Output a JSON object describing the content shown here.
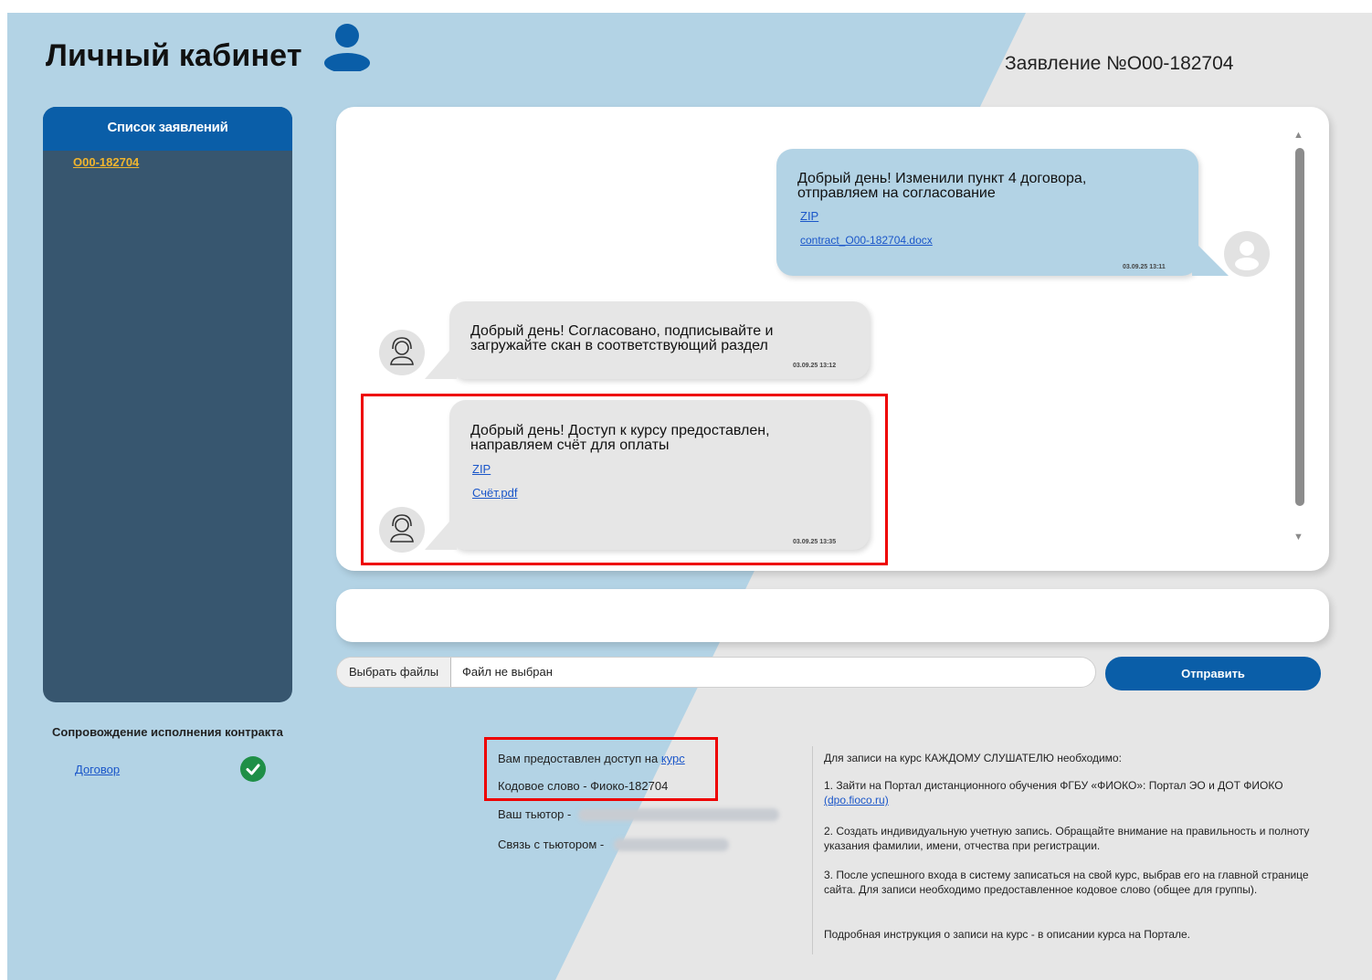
{
  "header": {
    "title": "Личный кабинет",
    "application_number": "Заявление №О00-182704"
  },
  "sidebar": {
    "title": "Список заявлений",
    "items": [
      {
        "label": "О00-182704"
      }
    ]
  },
  "support": {
    "title": "Сопровождение исполнения контракта",
    "contract_label": "Договор",
    "status": "check-icon"
  },
  "chat": {
    "messages": [
      {
        "direction": "outgoing",
        "text_line1": "Добрый день! Изменили пункт 4 договора,",
        "text_line2": "отправляем на согласование",
        "attachments": [
          "ZIP",
          "contract_О00-182704.docx"
        ],
        "time": "03.09.25 13:11"
      },
      {
        "direction": "incoming",
        "text_line1": "Добрый день! Согласовано, подписывайте и",
        "text_line2": "загружайте скан в соответствующий раздел",
        "attachments": [],
        "time": "03.09.25 13:12"
      },
      {
        "direction": "incoming",
        "text_line1": "Добрый день! Доступ к курсу предоставлен,",
        "text_line2": "направляем счёт для оплаты",
        "attachments": [
          "ZIP",
          "Счёт.pdf"
        ],
        "time": "03.09.25 13:35"
      }
    ]
  },
  "composer": {
    "choose_files": "Выбрать файлы",
    "no_file": "Файл не выбран",
    "send": "Отправить"
  },
  "access_info": {
    "access_text": "Вам предоставлен доступ на ",
    "access_link": "курс",
    "code_word": "Кодовое слово - Фиоко-182704",
    "tutor_label": "Ваш тьютор -",
    "tutor_contact_label": "Связь с тьютором -"
  },
  "instructions": {
    "intro": "Для записи на курс КАЖДОМУ СЛУШАТЕЛЮ необходимо:",
    "step1_text": "1. Зайти на Портал дистанционного обучения ФГБУ «ФИОКО»: Портал ЭО и ДОТ ФИОКО ",
    "step1_link": "(dpo.fioco.ru)",
    "step2": "2. Создать индивидуальную учетную запись. Обращайте внимание на правильность и полноту указания фамилии, имени, отчества при регистрации.",
    "step3": "3. После успешного входа в систему записаться на свой курс, выбрав его на главной странице сайта. Для записи необходимо предоставленное кодовое слово (общее для группы).",
    "footer": "Подробная инструкция о записи на курс - в описании курса на Портале."
  },
  "colors": {
    "brand_blue": "#0a5ea8",
    "sidebar_bg": "#37566f",
    "highlight": "#ee0000",
    "link": "#1a56c9",
    "accent_orange": "#f0b52e",
    "success_green": "#1f8f47"
  }
}
